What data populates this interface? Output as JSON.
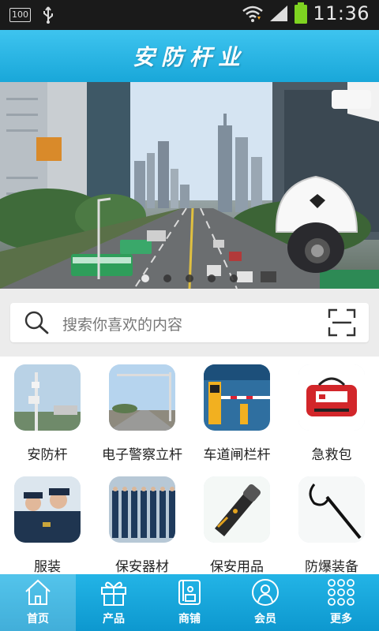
{
  "status_bar": {
    "left_badge": "100",
    "time": "11:36",
    "icons": [
      "usb-icon",
      "wifi-icon",
      "signal-icon",
      "battery-icon"
    ]
  },
  "header": {
    "title": "安防杆业"
  },
  "banner": {
    "slide_count": 5,
    "active_slide": 0
  },
  "search": {
    "placeholder": "搜索你喜欢的内容",
    "icons": [
      "search-icon",
      "scan-icon"
    ]
  },
  "categories": [
    {
      "label": "安防杆"
    },
    {
      "label": "电子警察立杆"
    },
    {
      "label": "车道闸栏杆"
    },
    {
      "label": "急救包"
    },
    {
      "label": "服装"
    },
    {
      "label": "保安器材"
    },
    {
      "label": "保安用品"
    },
    {
      "label": "防爆装备"
    }
  ],
  "bottom_nav": [
    {
      "label": "首页",
      "icon": "home-icon",
      "active": true
    },
    {
      "label": "产品",
      "icon": "gift-icon",
      "active": false
    },
    {
      "label": "商铺",
      "icon": "shop-icon",
      "active": false
    },
    {
      "label": "会员",
      "icon": "member-icon",
      "active": false
    },
    {
      "label": "更多",
      "icon": "more-grid-icon",
      "active": false
    }
  ],
  "colors": {
    "accent": "#1aa8da",
    "status_bar": "#1a1a1a",
    "battery": "#7ed321"
  }
}
